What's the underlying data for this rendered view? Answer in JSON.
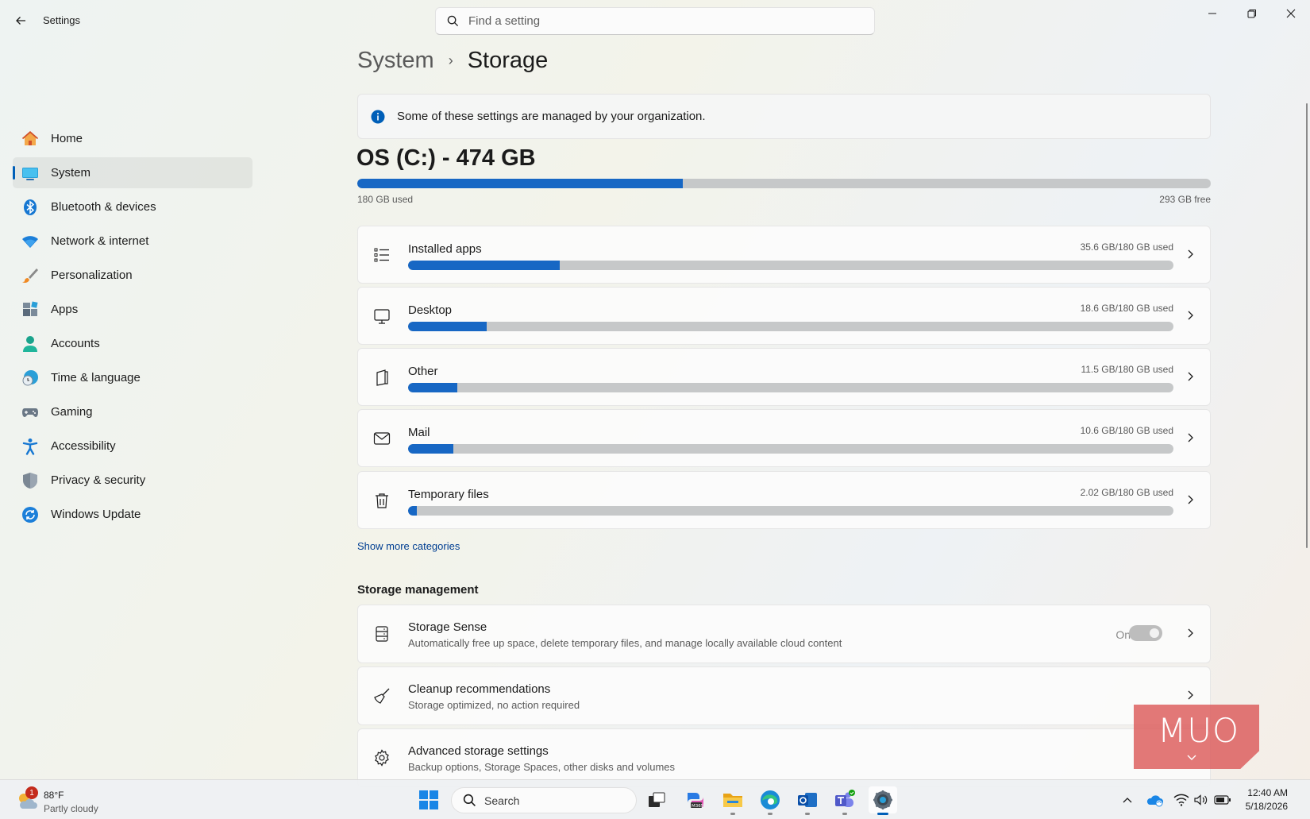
{
  "window": {
    "app_title": "Settings",
    "search_placeholder": "Find a setting"
  },
  "sidebar": {
    "items": [
      {
        "label": "Home",
        "icon": "home-icon"
      },
      {
        "label": "System",
        "icon": "system-icon",
        "active": true
      },
      {
        "label": "Bluetooth & devices",
        "icon": "bluetooth-icon"
      },
      {
        "label": "Network & internet",
        "icon": "wifi-icon"
      },
      {
        "label": "Personalization",
        "icon": "brush-icon"
      },
      {
        "label": "Apps",
        "icon": "apps-icon"
      },
      {
        "label": "Accounts",
        "icon": "person-icon"
      },
      {
        "label": "Time & language",
        "icon": "clock-globe-icon"
      },
      {
        "label": "Gaming",
        "icon": "gamepad-icon"
      },
      {
        "label": "Accessibility",
        "icon": "accessibility-icon"
      },
      {
        "label": "Privacy & security",
        "icon": "shield-icon"
      },
      {
        "label": "Windows Update",
        "icon": "update-icon"
      }
    ]
  },
  "breadcrumb": {
    "parent": "System",
    "separator": "›",
    "current": "Storage"
  },
  "info": {
    "text": "Some of these settings are managed by your organization."
  },
  "drive": {
    "title": "OS (C:) - 474 GB",
    "used_label": "180 GB used",
    "free_label": "293 GB free",
    "used_fraction": 0.381
  },
  "categories": [
    {
      "label": "Installed apps",
      "size": "35.6 GB/180 GB used",
      "fraction": 0.198,
      "icon": "list-icon"
    },
    {
      "label": "Desktop",
      "size": "18.6 GB/180 GB used",
      "fraction": 0.103,
      "icon": "monitor-icon"
    },
    {
      "label": "Other",
      "size": "11.5 GB/180 GB used",
      "fraction": 0.064,
      "icon": "document-icon"
    },
    {
      "label": "Mail",
      "size": "10.6 GB/180 GB used",
      "fraction": 0.059,
      "icon": "mail-icon"
    },
    {
      "label": "Temporary files",
      "size": "2.02 GB/180 GB used",
      "fraction": 0.011,
      "icon": "trash-icon"
    }
  ],
  "show_more": "Show more categories",
  "management": {
    "section_title": "Storage management",
    "items": [
      {
        "title": "Storage Sense",
        "desc": "Automatically free up space, delete temporary files, and manage locally available cloud content",
        "toggle_label": "On",
        "icon": "storage-drive-icon"
      },
      {
        "title": "Cleanup recommendations",
        "desc": "Storage optimized, no action required",
        "icon": "broom-icon"
      },
      {
        "title": "Advanced storage settings",
        "desc": "Backup options, Storage Spaces, other disks and volumes",
        "icon": "gear-icon"
      }
    ]
  },
  "watermark": {
    "text": "MUO"
  },
  "taskbar": {
    "weather_temp": "88°F",
    "weather_cond": "Partly cloudy",
    "weather_badge": "1",
    "search_label": "Search",
    "time": "12:40 AM",
    "date": "5/18/2026"
  },
  "colors": {
    "accent": "#005fb8",
    "bar_fill": "#1767c4",
    "bar_track": "#c6c8c9"
  }
}
